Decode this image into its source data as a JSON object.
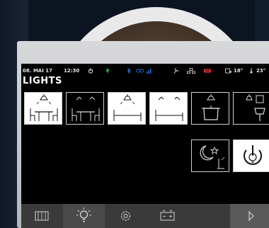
{
  "status": {
    "date": "08. MAI 17",
    "time": "12:30",
    "temp_inside": "18°",
    "temp_outside": "23°"
  },
  "page_title": "LIGHTS",
  "tiles": [
    {
      "name": "dining-light-1",
      "icon": "lamp-table-icon",
      "state": "on"
    },
    {
      "name": "dining-light-2",
      "icon": "spotlight-table-icon",
      "state": "off"
    },
    {
      "name": "bed-light",
      "icon": "lamp-bed-icon",
      "state": "on"
    },
    {
      "name": "bed-spotlight",
      "icon": "spotlight-bed-icon",
      "state": "on"
    },
    {
      "name": "kitchen-light",
      "icon": "lamp-pot-icon",
      "state": "off"
    },
    {
      "name": "bathroom-light",
      "icon": "lamp-sink-icon",
      "state": "off"
    },
    {
      "name": "night-mode",
      "icon": "moon-icon",
      "state": "off"
    },
    {
      "name": "all-lights-power",
      "icon": "bulb-power-icon",
      "state": "on"
    }
  ],
  "nav": [
    {
      "icon": "radiator-icon",
      "active": false
    },
    {
      "icon": "bulb-icon",
      "active": true
    },
    {
      "icon": "gear-icon",
      "active": false
    },
    {
      "icon": "battery-icon",
      "active": false
    },
    {
      "icon": "play-icon",
      "active": false
    }
  ],
  "colors": {
    "accent_green": "#1fa34a",
    "accent_blue": "#2a6fd6",
    "accent_red": "#d42b2b",
    "nav_bg": "#3a3a3a",
    "nav_active": "#4a4a4a"
  }
}
